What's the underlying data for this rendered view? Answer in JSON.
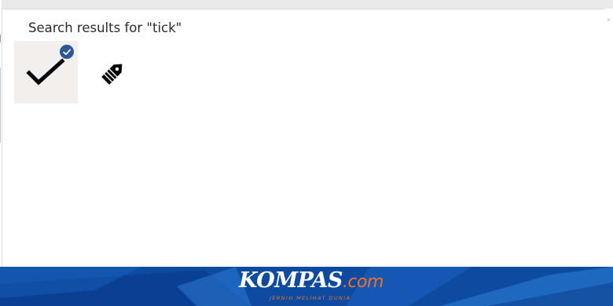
{
  "search": {
    "title": "Search results for \"tick\""
  },
  "results": [
    {
      "icon": "checkmark-icon",
      "selected": true
    },
    {
      "icon": "tag-icon",
      "selected": false
    }
  ],
  "banner": {
    "brand_main": "KOMPAS",
    "brand_suffix": ".com",
    "tagline": "JERNIH MELIHAT DUNIA"
  },
  "colors": {
    "selected_tile_bg": "#f1f0ee",
    "selection_badge": "#2b5797",
    "banner_blue": "#1260b8",
    "brand_orange": "#f37021"
  }
}
